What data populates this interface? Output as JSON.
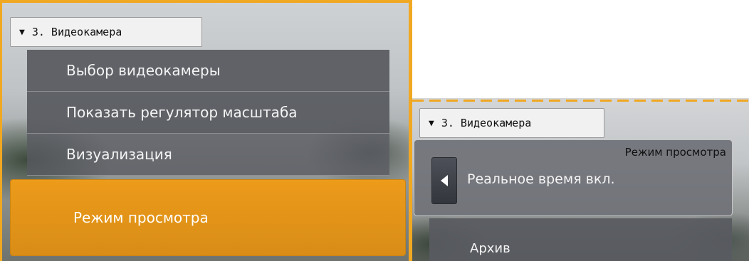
{
  "left_panel": {
    "camera_button": {
      "arrow": "▼",
      "label": "3. Видеокамера"
    },
    "menu": {
      "items": [
        {
          "label": "Выбор видеокамеры"
        },
        {
          "label": "Показать регулятор масштаба"
        },
        {
          "label": "Визуализация"
        }
      ],
      "active_item": {
        "label": "Режим просмотра"
      }
    }
  },
  "right_panel": {
    "camera_button": {
      "arrow": "▼",
      "label": "3. Видеокамера"
    },
    "mode_box": {
      "title": "Режим просмотра",
      "value": "Реальное время вкл."
    },
    "next_item": {
      "label": "Архив"
    }
  },
  "colors": {
    "accent": "#f0a822",
    "active_menu": "#e0931a",
    "menu_bg": "#585a60"
  }
}
